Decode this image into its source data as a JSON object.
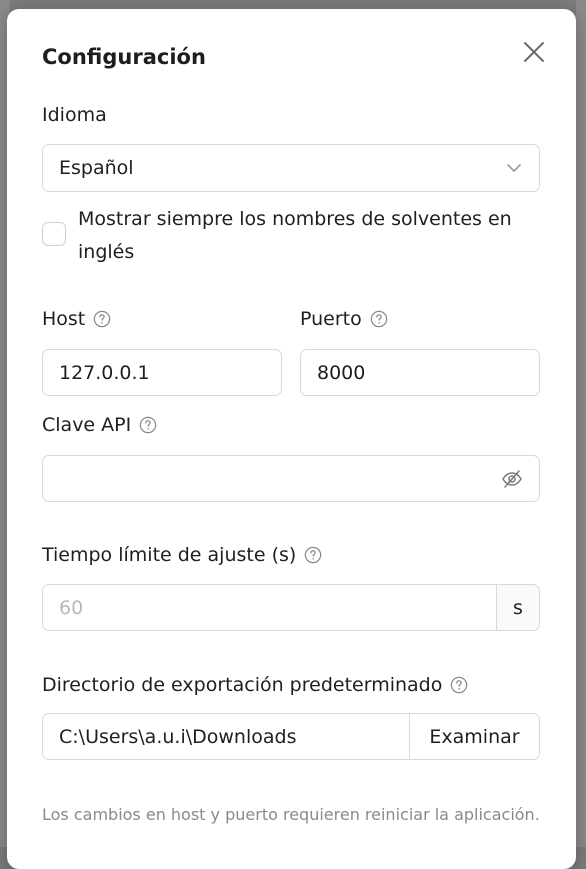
{
  "dialog": {
    "title": "Configuración",
    "close_icon": "close-icon"
  },
  "language": {
    "label": "Idioma",
    "selected": "Español",
    "icon": "chevron-down-icon"
  },
  "checkbox": {
    "label": "Mostrar siempre los nombres de solventes en inglés",
    "checked": false
  },
  "host": {
    "label": "Host",
    "value": "127.0.0.1",
    "icon": "help-icon"
  },
  "port": {
    "label": "Puerto",
    "value": "8000",
    "icon": "help-icon"
  },
  "api_key": {
    "label": "Clave API",
    "value": "",
    "icon": "help-icon",
    "toggle_icon": "eye-off-icon"
  },
  "timeout": {
    "label": "Tiempo límite de ajuste (s)",
    "placeholder": "60",
    "unit": "s",
    "icon": "help-icon"
  },
  "export_dir": {
    "label": "Directorio de exportación predeterminado",
    "value": "C:\\Users\\a.u.i\\Downloads",
    "browse_label": "Examinar",
    "icon": "help-icon"
  },
  "footer_note": "Los cambios en host y puerto requieren reiniciar la aplicación."
}
